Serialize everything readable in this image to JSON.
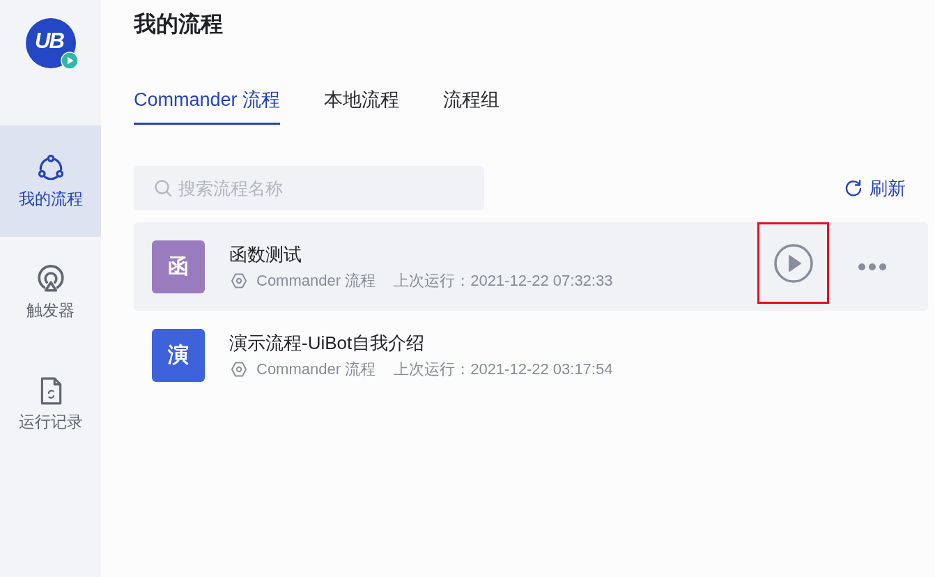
{
  "sidebar": {
    "logo": "UB",
    "items": [
      {
        "kind": "flows",
        "label": "我的流程",
        "selected": true
      },
      {
        "kind": "trigger",
        "label": "触发器",
        "selected": false
      },
      {
        "kind": "records",
        "label": "运行记录",
        "selected": false
      }
    ]
  },
  "page_title": "我的流程",
  "tabs": [
    {
      "label": "Commander 流程",
      "selected": true
    },
    {
      "label": "本地流程",
      "selected": false
    },
    {
      "label": "流程组",
      "selected": false
    }
  ],
  "search": {
    "placeholder": "搜索流程名称"
  },
  "refresh_button": "刷新",
  "rows": [
    {
      "avatar": "函",
      "color": "#9a7bbd",
      "name": "函数测试",
      "type": "Commander 流程",
      "last_run": "上次运行：2021-12-22 07:32:33",
      "hovered": true,
      "run_highlighted": true
    },
    {
      "avatar": "演",
      "color": "#3e62dc",
      "name": "演示流程-UiBot自我介绍",
      "type": "Commander 流程",
      "last_run": "上次运行：2021-12-22 03:17:54",
      "hovered": false
    }
  ]
}
